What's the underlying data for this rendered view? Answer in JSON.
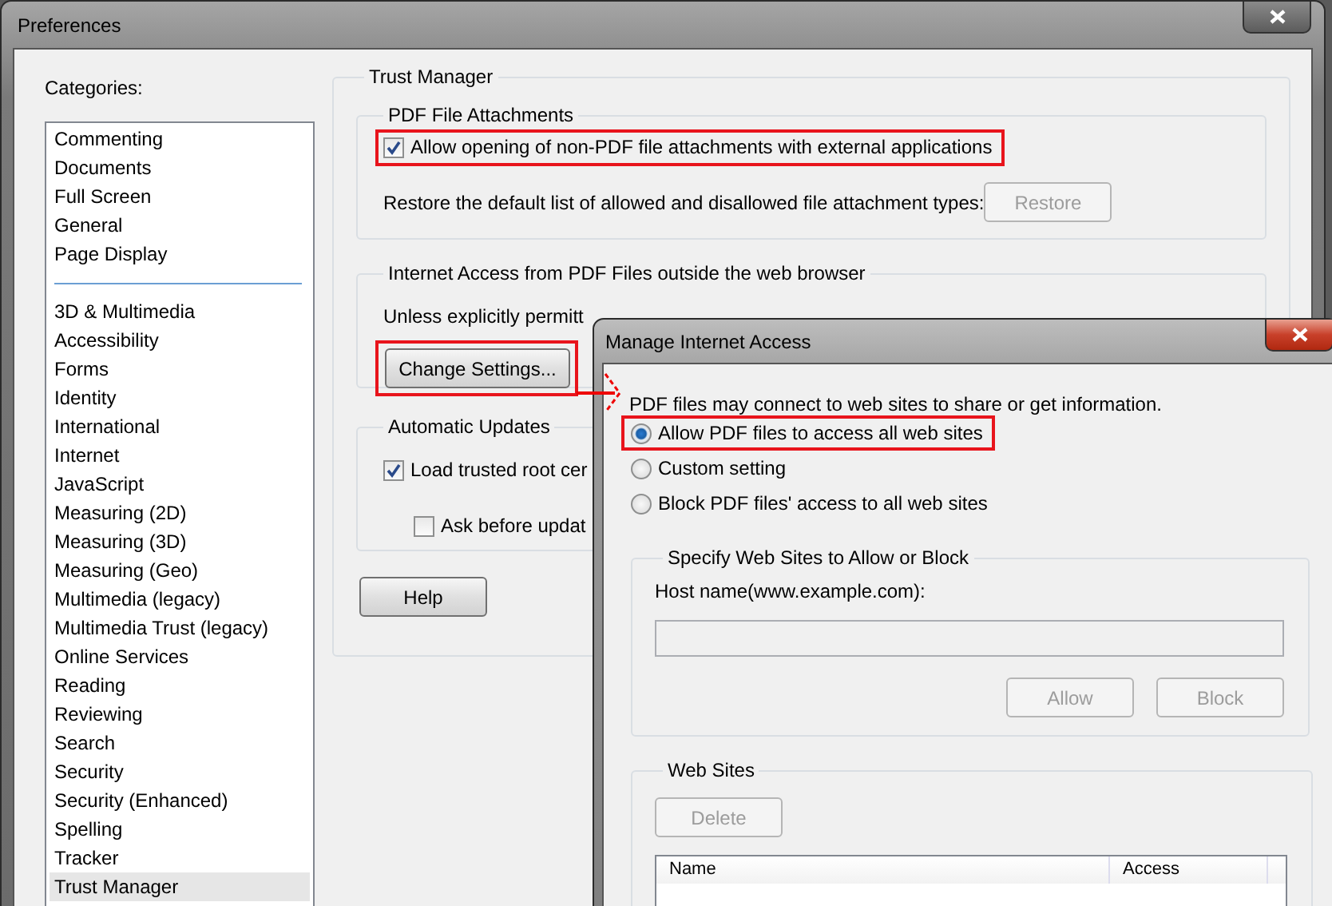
{
  "preferences_window": {
    "title": "Preferences",
    "categories_label": "Categories:",
    "category_groups": [
      {
        "items": [
          {
            "label": "Commenting",
            "selected": false
          },
          {
            "label": "Documents",
            "selected": false
          },
          {
            "label": "Full Screen",
            "selected": false
          },
          {
            "label": "General",
            "selected": false
          },
          {
            "label": "Page Display",
            "selected": false
          }
        ]
      },
      {
        "items": [
          {
            "label": "3D & Multimedia",
            "selected": false
          },
          {
            "label": "Accessibility",
            "selected": false
          },
          {
            "label": "Forms",
            "selected": false
          },
          {
            "label": "Identity",
            "selected": false
          },
          {
            "label": "International",
            "selected": false
          },
          {
            "label": "Internet",
            "selected": false
          },
          {
            "label": "JavaScript",
            "selected": false
          },
          {
            "label": "Measuring (2D)",
            "selected": false
          },
          {
            "label": "Measuring (3D)",
            "selected": false
          },
          {
            "label": "Measuring (Geo)",
            "selected": false
          },
          {
            "label": "Multimedia (legacy)",
            "selected": false
          },
          {
            "label": "Multimedia Trust (legacy)",
            "selected": false
          },
          {
            "label": "Online Services",
            "selected": false
          },
          {
            "label": "Reading",
            "selected": false
          },
          {
            "label": "Reviewing",
            "selected": false
          },
          {
            "label": "Search",
            "selected": false
          },
          {
            "label": "Security",
            "selected": false
          },
          {
            "label": "Security (Enhanced)",
            "selected": false
          },
          {
            "label": "Spelling",
            "selected": false
          },
          {
            "label": "Tracker",
            "selected": false
          },
          {
            "label": "Trust Manager",
            "selected": true
          }
        ]
      }
    ],
    "section_title": "Trust Manager",
    "pdf_attachments": {
      "title": "PDF File Attachments",
      "allow_checkbox": {
        "label": "Allow opening of non-PDF file attachments with external applications",
        "checked": true,
        "highlighted": true
      },
      "restore_text": "Restore the default list of allowed and disallowed file attachment types:",
      "restore_button": {
        "label": "Restore",
        "disabled": true
      }
    },
    "internet_access": {
      "title": "Internet Access from PDF Files outside the web browser",
      "text": "Unless explicitly permitt",
      "change_settings_button": {
        "label": "Change Settings...",
        "highlighted": true
      }
    },
    "automatic_updates": {
      "title": "Automatic Updates",
      "load_checkbox": {
        "label": "Load trusted root cer",
        "checked": true,
        "highlighted": false
      },
      "ask_checkbox": {
        "label": "Ask before updat",
        "checked": false,
        "highlighted": false
      }
    },
    "help_button": {
      "label": "Help",
      "disabled": false
    }
  },
  "dialog": {
    "title": "Manage Internet Access",
    "intro": "PDF files may connect to web sites to share or get information.",
    "options": [
      {
        "label": "Allow PDF files to access all web sites",
        "selected": true,
        "highlighted": true
      },
      {
        "label": "Custom setting",
        "selected": false,
        "highlighted": false
      },
      {
        "label": "Block PDF files' access to all web sites",
        "selected": false,
        "highlighted": false
      }
    ],
    "specify_group": {
      "title": "Specify Web Sites to Allow or Block",
      "host_label": "Host name(www.example.com):",
      "allow_button": {
        "label": "Allow",
        "disabled": true
      },
      "block_button": {
        "label": "Block",
        "disabled": true
      }
    },
    "web_sites_group": {
      "title": "Web Sites",
      "delete_button": {
        "label": "Delete",
        "disabled": true
      },
      "columns": [
        "Name",
        "Access"
      ]
    }
  }
}
